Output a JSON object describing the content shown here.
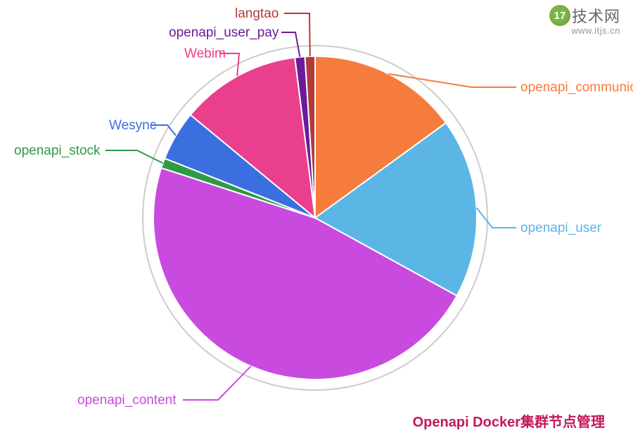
{
  "chart_data": {
    "type": "pie",
    "series": [
      {
        "name": "openapi_communication",
        "value": 15,
        "color": "#f57c3c"
      },
      {
        "name": "openapi_user",
        "value": 18,
        "color": "#5bb6e6"
      },
      {
        "name": "openapi_content",
        "value": 47,
        "color": "#c94adf"
      },
      {
        "name": "openapi_stock",
        "value": 1,
        "color": "#2e9b42"
      },
      {
        "name": "Wesync",
        "value": 5,
        "color": "#3b6fe0"
      },
      {
        "name": "Webim",
        "value": 12,
        "color": "#ea3f8d"
      },
      {
        "name": "openapi_user_pay",
        "value": 1,
        "color": "#6a1b9a"
      },
      {
        "name": "langtao",
        "value": 1,
        "color": "#b23a3a"
      }
    ],
    "title": "",
    "legend_position": "outside"
  },
  "watermark": {
    "badge": "17",
    "name": "技术网",
    "url": "www.itjs.cn"
  },
  "caption": "Openapi Docker集群节点管理",
  "labels": {
    "openapi_communication": "openapi_communication",
    "openapi_user": "openapi_user",
    "openapi_content": "openapi_content",
    "openapi_stock": "openapi_stock",
    "Wesync": "Wesync",
    "Webim": "Webim",
    "openapi_user_pay": "openapi_user_pay",
    "langtao": "langtao"
  }
}
